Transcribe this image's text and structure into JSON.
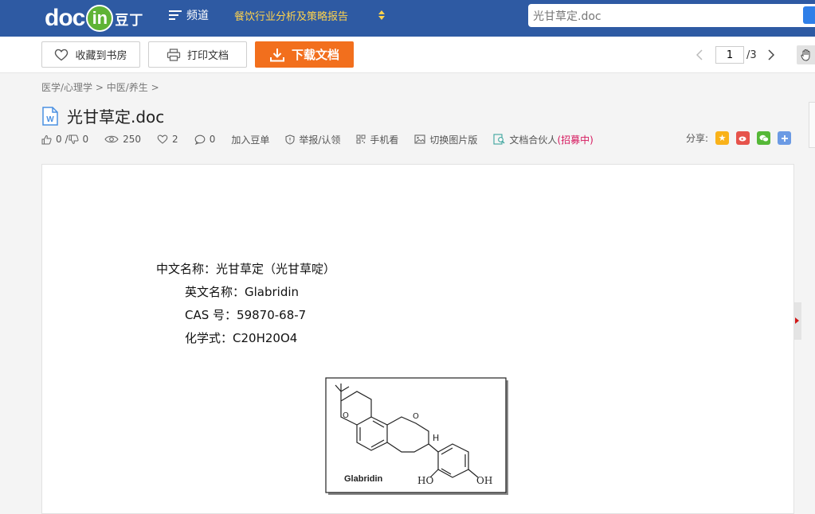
{
  "header": {
    "logo_text": "doc",
    "logo_in": "in",
    "logo_cn": "豆丁",
    "channel_label": "频道",
    "report_link": "餐饮行业分析及策略报告",
    "search_value": "光甘草定.doc"
  },
  "toolbar": {
    "favorite_label": "收藏到书房",
    "print_label": "打印文档",
    "download_label": "下载文档",
    "current_page": "1",
    "total_pages": "/3"
  },
  "breadcrumb": {
    "level1": "医学/心理学",
    "sep1": " > ",
    "level2": "中医/养生",
    "sep2": " >"
  },
  "document": {
    "title": "光甘草定.doc",
    "file_icon": "word-file-icon"
  },
  "meta": {
    "likes": "0 / ",
    "dislikes": "0",
    "views": "250",
    "hearts": "2",
    "comments": "0",
    "add_to_douding": "加入豆单",
    "report": "举报/认领",
    "mobile": "手机看",
    "switch_image": "切换图片版",
    "partner": "文档合伙人",
    "recruiting": "(招募中)"
  },
  "share": {
    "label": "分享:",
    "colors": {
      "qzone": "#f9b21a",
      "weibo": "#e6534b",
      "wechat": "#55b837",
      "more": "#6b9ae4"
    }
  },
  "content": {
    "line1": "中文名称：光甘草定（光甘草啶）",
    "line2_label": "英文名称：",
    "line2_value": "Glabridin",
    "line3_label": "CAS 号：",
    "line3_value": "59870-68-7",
    "line4_label": "化学式：",
    "line4_value": "C20H20O4",
    "figure_label": "Glabridin",
    "figure_ho": "HO",
    "figure_oh": "OH",
    "figure_h": "H"
  },
  "colors": {
    "topbar": "#2e5aa3",
    "download": "#f26f1d",
    "highlight": "#d6185e"
  }
}
